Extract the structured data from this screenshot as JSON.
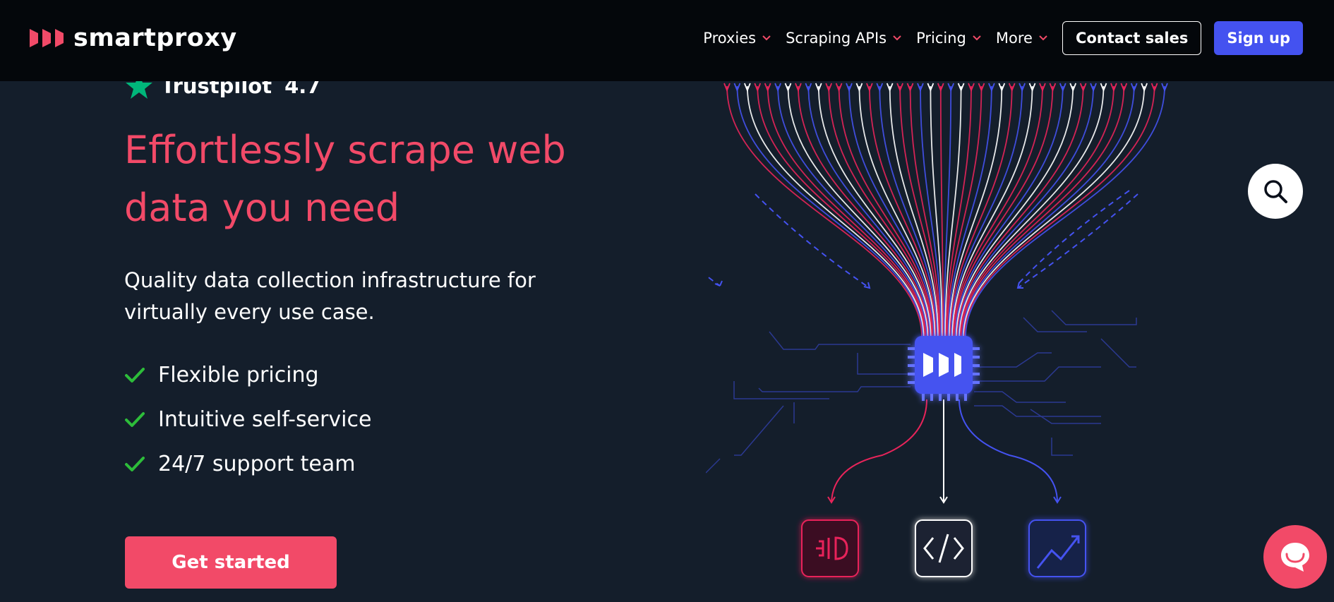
{
  "brand": {
    "name": "smartproxy"
  },
  "nav": {
    "items": [
      {
        "label": "Proxies"
      },
      {
        "label": "Scraping APIs"
      },
      {
        "label": "Pricing"
      },
      {
        "label": "More"
      }
    ],
    "contact_label": "Contact sales",
    "signup_label": "Sign up"
  },
  "trustpilot": {
    "name": "Trustpilot",
    "score": "4.7"
  },
  "hero": {
    "headline": "Effortlessly scrape web data you need",
    "subtext": "Quality data collection infrastructure for virtually every use case.",
    "features": [
      "Flexible pricing",
      "Intuitive self-service",
      "24/7 support team"
    ],
    "cta_label": "Get started"
  },
  "colors": {
    "accent": "#f24a68",
    "primary_blue": "#4452f0",
    "background": "#141e2b",
    "header": "#04070b",
    "check_green": "#2dbd3a"
  },
  "icons": {
    "logo": "smartproxy-logo-icon",
    "search": "search-icon",
    "chat": "chat-icon",
    "check": "check-icon",
    "chevron": "chevron-down-icon"
  }
}
